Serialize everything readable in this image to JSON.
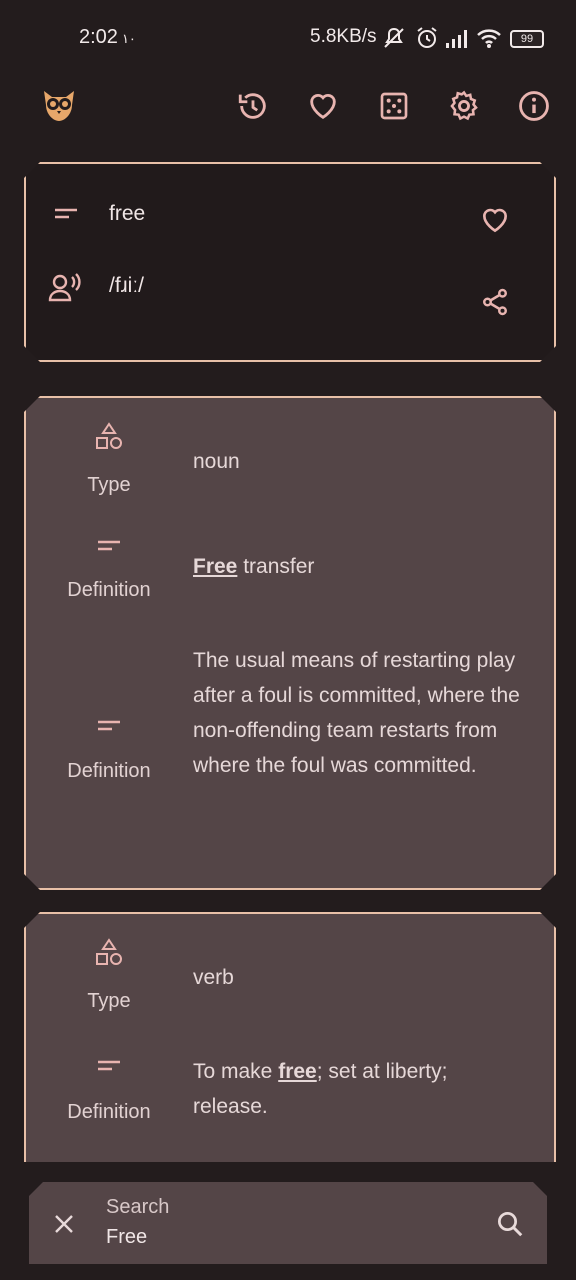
{
  "status": {
    "time": "2:02",
    "time_suffix": "١٠",
    "net_speed": "5.8KB/s",
    "battery": "99"
  },
  "toolbar": {
    "icons": [
      "owl-logo-icon",
      "history-icon",
      "heart-icon",
      "dice-icon",
      "gear-icon",
      "info-icon"
    ]
  },
  "word": {
    "term": "free",
    "pronunciation": "/fɹiː/"
  },
  "entries": [
    {
      "type_label": "Type",
      "type_value": "noun",
      "definitions": [
        {
          "label": "Definition",
          "bold": "Free",
          "text": " transfer"
        },
        {
          "label": "Definition",
          "bold": "",
          "text": "The usual means of restarting play after a foul is committed, where the non-offending team restarts from where the foul was committed."
        }
      ]
    },
    {
      "type_label": "Type",
      "type_value": "verb",
      "definitions": [
        {
          "label": "Definition",
          "prefix": "To make ",
          "bold": "free",
          "text": "; set at liberty; release."
        }
      ]
    }
  ],
  "search": {
    "label": "Search",
    "value": "Free"
  },
  "colors": {
    "background": "#231c1d",
    "card": "#544547",
    "accent": "#e8c0a8",
    "icon": "#e8b4b0",
    "logo": "#e7a76a"
  }
}
